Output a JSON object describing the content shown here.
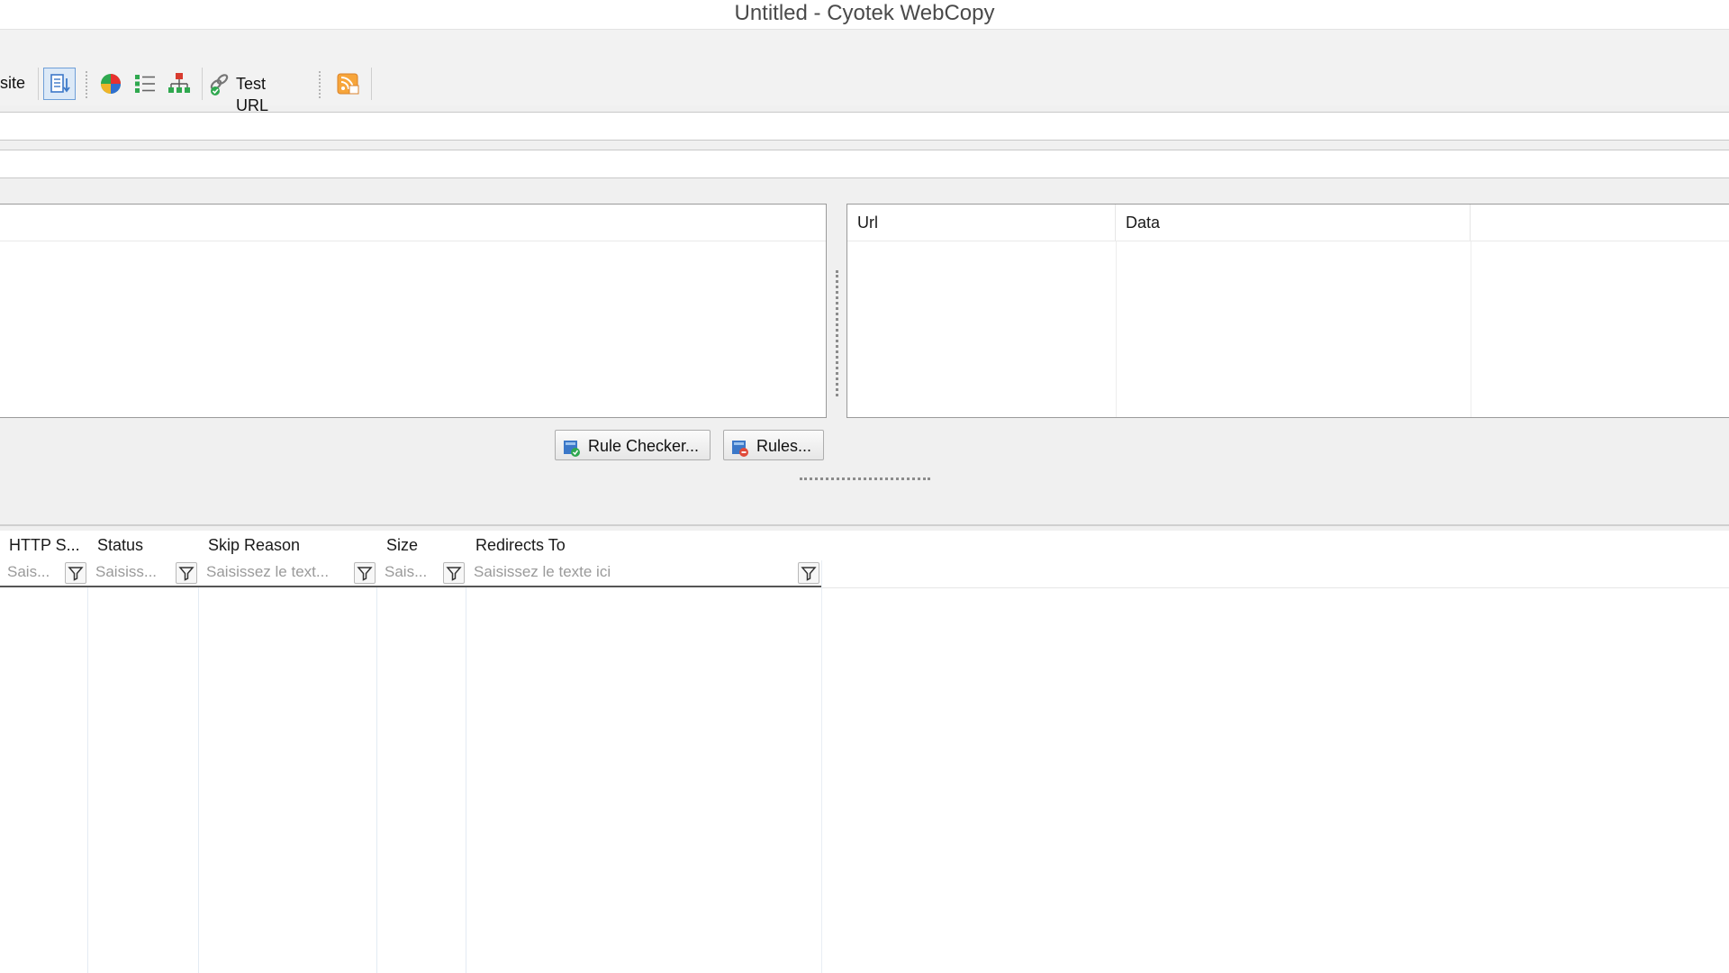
{
  "window": {
    "title": "Untitled - Cyotek WebCopy"
  },
  "toolbar": {
    "copy_label_partial": "site",
    "test_url_label": "Test URL",
    "icons": [
      "download-list-icon",
      "pie-chart-icon",
      "list-icon",
      "sitemap-icon",
      "link-check-icon",
      "rss-icon"
    ]
  },
  "right_pane": {
    "columns": [
      "Url",
      "Data"
    ]
  },
  "rules": {
    "rule_checker_label": "Rule Checker...",
    "rules_label": "Rules..."
  },
  "grid": {
    "columns": [
      {
        "header": "HTTP S...",
        "placeholder": "Sais..."
      },
      {
        "header": "Status",
        "placeholder": "Saisiss..."
      },
      {
        "header": "Skip Reason",
        "placeholder": "Saisissez le text..."
      },
      {
        "header": "Size",
        "placeholder": "Sais..."
      },
      {
        "header": "Redirects To",
        "placeholder": "Saisissez le texte ici"
      }
    ]
  },
  "colors": {
    "accent_blue": "#3c78c8",
    "border": "#9a9a9a",
    "background": "#f0f0f0"
  }
}
